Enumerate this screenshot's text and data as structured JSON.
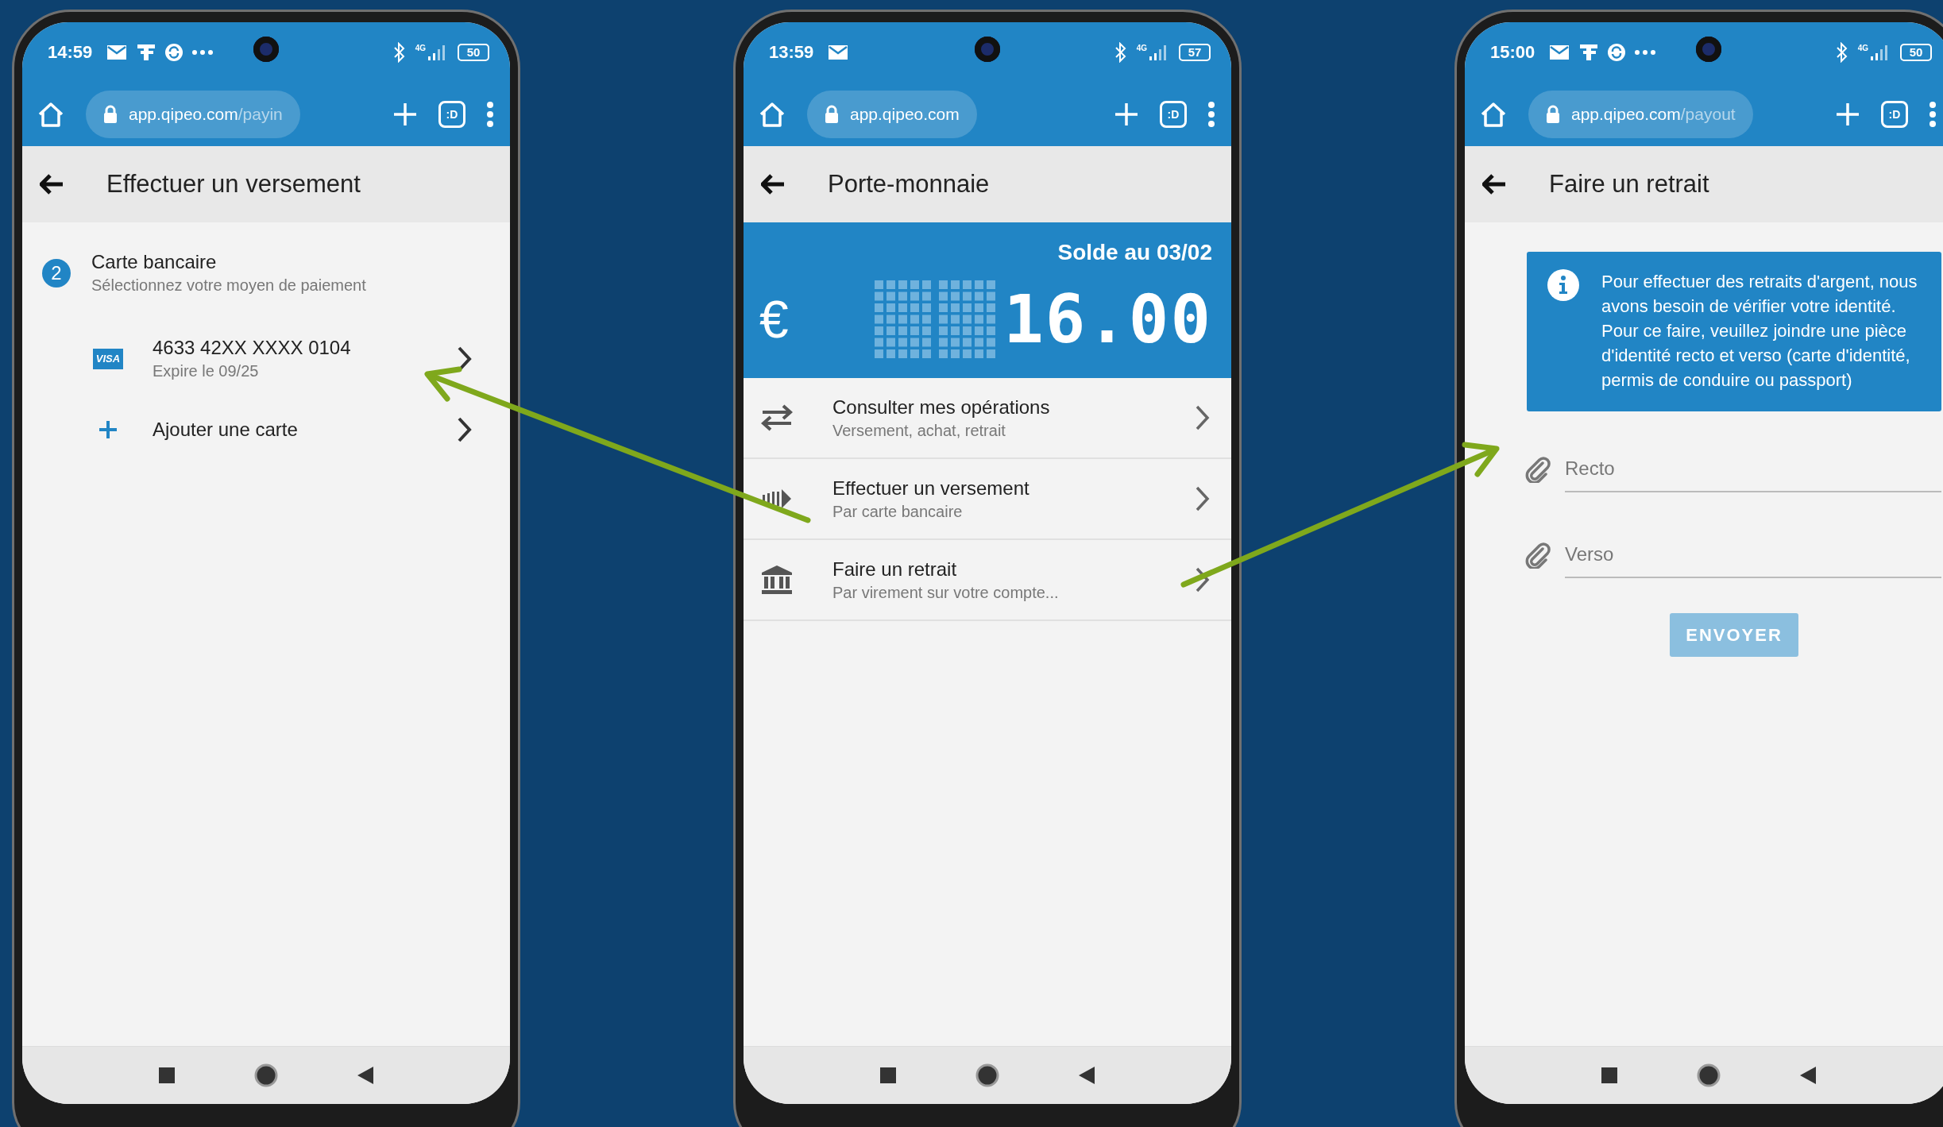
{
  "phones": [
    {
      "kind": "payin",
      "time": "14:59",
      "notifications": [
        {
          "kind": "mail"
        },
        {
          "kind": "app"
        },
        {
          "kind": "circle"
        },
        {
          "kind": "more"
        }
      ],
      "network": "4G",
      "battery": "50",
      "url_host": "app.qipeo.com",
      "url_path": "/payin",
      "tab_badge": ":D",
      "title": "Effectuer un versement",
      "step": {
        "number": "2",
        "title": "Carte bancaire",
        "subtitle": "Sélectionnez votre moyen de paiement"
      },
      "items": [
        {
          "kind": "card",
          "brand": "VISA",
          "title": "4633 42XX XXXX 0104",
          "subtitle": "Expire le 09/25"
        },
        {
          "kind": "add",
          "title": "Ajouter une carte"
        }
      ]
    },
    {
      "kind": "wallet",
      "time": "13:59",
      "notifications": [
        {
          "kind": "mail"
        }
      ],
      "network": "4G",
      "battery": "57",
      "url_host": "app.qipeo.com",
      "tab_badge": ":D",
      "title": "Porte-monnaie",
      "balance": {
        "label": "Solde au 03/02",
        "currency": "€",
        "amount": "16.00"
      },
      "items": [
        {
          "kind": "transfer",
          "title": "Consulter mes opérations",
          "subtitle": "Versement, achat, retrait"
        },
        {
          "kind": "deposit",
          "title": "Effectuer un versement",
          "subtitle": "Par carte bancaire"
        },
        {
          "kind": "bank",
          "title": "Faire un retrait",
          "subtitle": "Par virement sur votre compte..."
        }
      ]
    },
    {
      "kind": "payout",
      "time": "15:00",
      "notifications": [
        {
          "kind": "mail"
        },
        {
          "kind": "app"
        },
        {
          "kind": "circle"
        },
        {
          "kind": "more"
        }
      ],
      "network": "4G",
      "battery": "50",
      "url_host": "app.qipeo.com",
      "url_path": "/payout",
      "tab_badge": ":D",
      "title": "Faire un retrait",
      "notice": "Pour effectuer des retraits d'argent, nous avons besoin de vérifier votre identité. Pour ce faire, veuillez joindre une pièce d'identité recto et verso (carte d'identité, permis de conduire ou passport)",
      "fields": [
        {
          "placeholder": "Recto"
        },
        {
          "placeholder": "Verso"
        }
      ],
      "button": {
        "label": "ENVOYER",
        "disabled": true
      }
    }
  ]
}
